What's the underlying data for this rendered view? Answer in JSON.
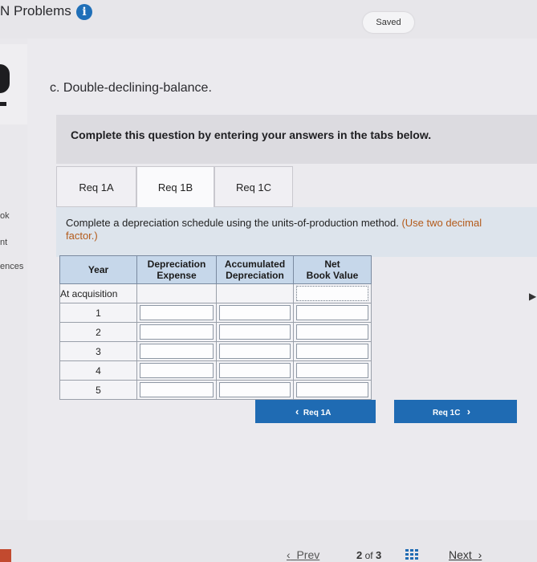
{
  "header": {
    "title": "N Problems",
    "saved_label": "Saved"
  },
  "sidebar": {
    "fragments": [
      "ok",
      "nt",
      "ences"
    ]
  },
  "part_label": "c. Double-declining-balance.",
  "instruction": "Complete this question by entering your answers in the tabs below.",
  "tabs": [
    {
      "label": "Req 1A",
      "active": false
    },
    {
      "label": "Req 1B",
      "active": true
    },
    {
      "label": "Req 1C",
      "active": false
    }
  ],
  "question": {
    "text": "Complete a depreciation schedule using the units-of-production method.",
    "note": "(Use two decimal",
    "note_cont": "factor.)"
  },
  "table": {
    "headers": {
      "year": "Year",
      "depreciation_1": "Depreciation",
      "depreciation_2": "Expense",
      "accumulated_1": "Accumulated",
      "accumulated_2": "Depreciation",
      "net_1": "Net",
      "net_2": "Book Value"
    },
    "acquisition_label": "At acquisition",
    "years": [
      "1",
      "2",
      "3",
      "4",
      "5"
    ]
  },
  "nav": {
    "prev_req": "Req 1A",
    "next_req": "Req 1C"
  },
  "footer": {
    "prev": "Prev",
    "page_current": "2",
    "page_of": "of",
    "page_total": "3",
    "next": "Next"
  },
  "colors": {
    "accent": "#1f6bb3",
    "header_cell": "#c6d7ea",
    "question_panel": "#dde4ec"
  }
}
